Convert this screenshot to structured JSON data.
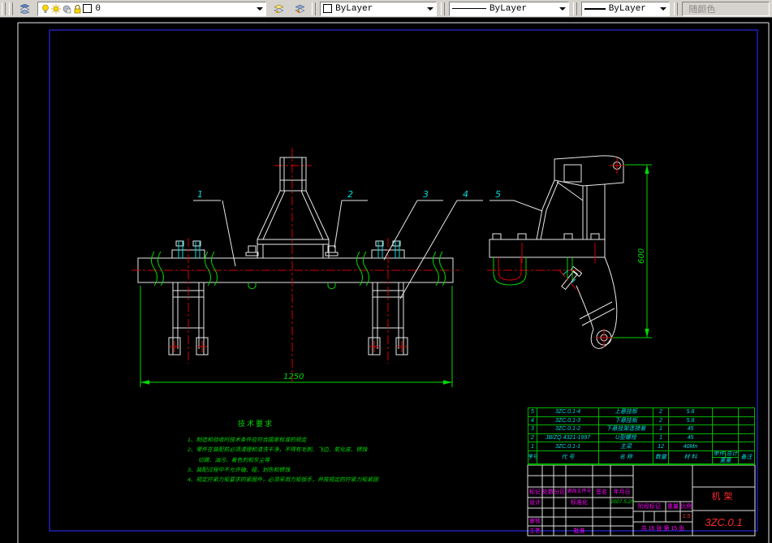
{
  "toolbar": {
    "layer_name": "0",
    "color": "ByLayer",
    "linetype": "ByLayer",
    "lineweight": "ByLayer",
    "plot_style": "随颜色"
  },
  "drawing": {
    "callouts": {
      "c1": "1",
      "c2": "2",
      "c3": "3",
      "c4": "4",
      "c5": "5"
    },
    "dims": {
      "length": "1250",
      "height": "600"
    },
    "tech": {
      "title": "技术要求",
      "l1": "1、制造和验收时技术条件应符合国家标准的规定",
      "l2": "2、零件在装配前必须清理和清洗干净，不得有毛刺、飞边、氧化皮、锈蚀",
      "l3": "切屑、油污、着色剂和灰尘等",
      "l4": "3、装配过程中不允许磕、碰、划伤和锈蚀",
      "l5": "4、规定拧紧力矩要求的紧固件，必须采用力矩扳手，并按规定的拧紧力矩紧固"
    }
  },
  "bom": {
    "header": {
      "no": "序号",
      "code": "代  号",
      "name": "名  称",
      "qty": "数量",
      "material": "材  料",
      "w1": "单件",
      "w2": "总计",
      "w": "重量",
      "remark": "备注"
    },
    "rows": [
      {
        "no": "5",
        "code": "3ZC.0.1-4",
        "name": "上悬挂板",
        "qty": "2",
        "material": "5.8"
      },
      {
        "no": "4",
        "code": "3ZC.0.1-3",
        "name": "下悬挂板",
        "qty": "2",
        "material": "5.8"
      },
      {
        "no": "3",
        "code": "3ZC.0.1-2",
        "name": "下悬挂架连接套",
        "qty": "1",
        "material": "45"
      },
      {
        "no": "2",
        "code": "JB/ZQ 4321-1997",
        "name": "U型螺栓",
        "qty": "1",
        "material": "45"
      },
      {
        "no": "1",
        "code": "3ZC.0.1-1",
        "name": "主梁",
        "qty": "12",
        "material": "40Mn"
      }
    ]
  },
  "titleblock": {
    "mark": "标记",
    "count": "处数",
    "zone": "分区",
    "change_doc": "更改文件号",
    "sign": "签名",
    "date_col": "年月日",
    "design": "设计",
    "standardize": "标准化",
    "date": "2007.5.25",
    "review": "审核",
    "process": "工艺",
    "approve": "批准",
    "stage": "阶段标记",
    "weight": "重量",
    "scale": "比例",
    "scale_value": "1:5",
    "sheet": "共 16 张 第 15 张",
    "title": "机架",
    "drawing_no": "3ZC.0.1"
  },
  "colors": {
    "cad_white": "#e8e8e8",
    "cad_green": "#00d800",
    "cad_cyan": "#00dcdc",
    "cad_red": "#d40000",
    "label_magenta": "#ff00ff",
    "title_red": "#ff2a2a",
    "frame_blue": "#2121b4",
    "toolbar_gray": "#d6d3ce"
  }
}
